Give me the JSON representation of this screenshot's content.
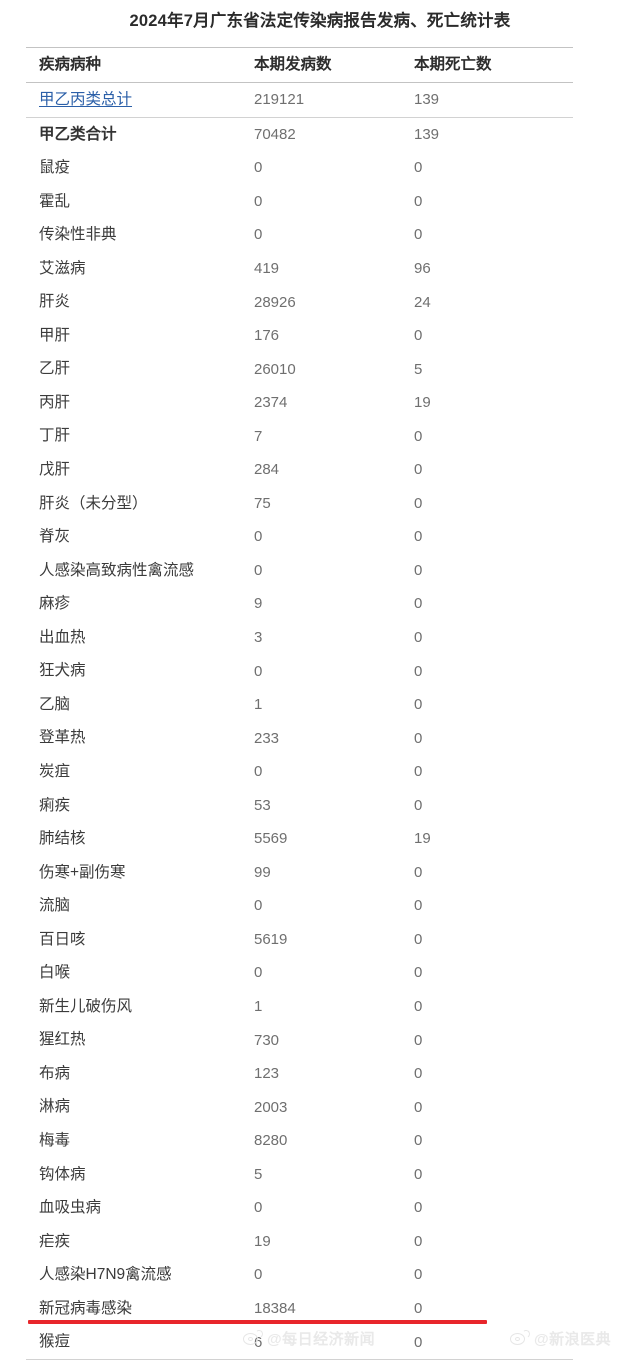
{
  "title": "2024年7月广东省法定传染病报告发病、死亡统计表",
  "table": {
    "columns": {
      "disease": "疾病病种",
      "cases": "本期发病数",
      "deaths": "本期死亡数"
    },
    "rows": [
      {
        "disease": "甲乙丙类总计",
        "cases": "219121",
        "deaths": "139",
        "style": "link"
      },
      {
        "disease": "甲乙类合计",
        "cases": "70482",
        "deaths": "139",
        "style": "total"
      },
      {
        "disease": "鼠疫",
        "cases": "0",
        "deaths": "0",
        "style": "normal"
      },
      {
        "disease": "霍乱",
        "cases": "0",
        "deaths": "0",
        "style": "normal"
      },
      {
        "disease": "传染性非典",
        "cases": "0",
        "deaths": "0",
        "style": "normal"
      },
      {
        "disease": "艾滋病",
        "cases": "419",
        "deaths": "96",
        "style": "normal"
      },
      {
        "disease": "肝炎",
        "cases": "28926",
        "deaths": "24",
        "style": "normal"
      },
      {
        "disease": "甲肝",
        "cases": "176",
        "deaths": "0",
        "style": "normal"
      },
      {
        "disease": "乙肝",
        "cases": "26010",
        "deaths": "5",
        "style": "normal"
      },
      {
        "disease": "丙肝",
        "cases": "2374",
        "deaths": "19",
        "style": "normal"
      },
      {
        "disease": "丁肝",
        "cases": "7",
        "deaths": "0",
        "style": "normal"
      },
      {
        "disease": "戊肝",
        "cases": "284",
        "deaths": "0",
        "style": "normal"
      },
      {
        "disease": "肝炎（未分型）",
        "cases": "75",
        "deaths": "0",
        "style": "normal"
      },
      {
        "disease": "脊灰",
        "cases": "0",
        "deaths": "0",
        "style": "normal"
      },
      {
        "disease": "人感染高致病性禽流感",
        "cases": "0",
        "deaths": "0",
        "style": "normal"
      },
      {
        "disease": "麻疹",
        "cases": "9",
        "deaths": "0",
        "style": "normal"
      },
      {
        "disease": "出血热",
        "cases": "3",
        "deaths": "0",
        "style": "normal"
      },
      {
        "disease": "狂犬病",
        "cases": "0",
        "deaths": "0",
        "style": "normal"
      },
      {
        "disease": "乙脑",
        "cases": "1",
        "deaths": "0",
        "style": "normal"
      },
      {
        "disease": "登革热",
        "cases": "233",
        "deaths": "0",
        "style": "normal"
      },
      {
        "disease": "炭疽",
        "cases": "0",
        "deaths": "0",
        "style": "normal"
      },
      {
        "disease": "痢疾",
        "cases": "53",
        "deaths": "0",
        "style": "normal"
      },
      {
        "disease": "肺结核",
        "cases": "5569",
        "deaths": "19",
        "style": "normal"
      },
      {
        "disease": "伤寒+副伤寒",
        "cases": "99",
        "deaths": "0",
        "style": "normal"
      },
      {
        "disease": "流脑",
        "cases": "0",
        "deaths": "0",
        "style": "normal"
      },
      {
        "disease": "百日咳",
        "cases": "5619",
        "deaths": "0",
        "style": "normal"
      },
      {
        "disease": "白喉",
        "cases": "0",
        "deaths": "0",
        "style": "normal"
      },
      {
        "disease": "新生儿破伤风",
        "cases": "1",
        "deaths": "0",
        "style": "normal"
      },
      {
        "disease": "猩红热",
        "cases": "730",
        "deaths": "0",
        "style": "normal"
      },
      {
        "disease": "布病",
        "cases": "123",
        "deaths": "0",
        "style": "normal"
      },
      {
        "disease": "淋病",
        "cases": "2003",
        "deaths": "0",
        "style": "normal"
      },
      {
        "disease": "梅毒",
        "cases": "8280",
        "deaths": "0",
        "style": "normal"
      },
      {
        "disease": "钩体病",
        "cases": "5",
        "deaths": "0",
        "style": "normal"
      },
      {
        "disease": "血吸虫病",
        "cases": "0",
        "deaths": "0",
        "style": "normal"
      },
      {
        "disease": "疟疾",
        "cases": "19",
        "deaths": "0",
        "style": "normal"
      },
      {
        "disease": "人感染H7N9禽流感",
        "cases": "0",
        "deaths": "0",
        "style": "normal"
      },
      {
        "disease": "新冠病毒感染",
        "cases": "18384",
        "deaths": "0",
        "style": "highlight"
      },
      {
        "disease": "猴痘",
        "cases": "6",
        "deaths": "0",
        "style": "normal"
      }
    ]
  },
  "highlight": {
    "color": "#e8262b",
    "row_disease": "新冠病毒感染"
  },
  "watermarks": [
    {
      "text": "@每日经济新闻",
      "position": "bottom-center"
    },
    {
      "text": "@新浪医典",
      "position": "bottom-right"
    }
  ]
}
